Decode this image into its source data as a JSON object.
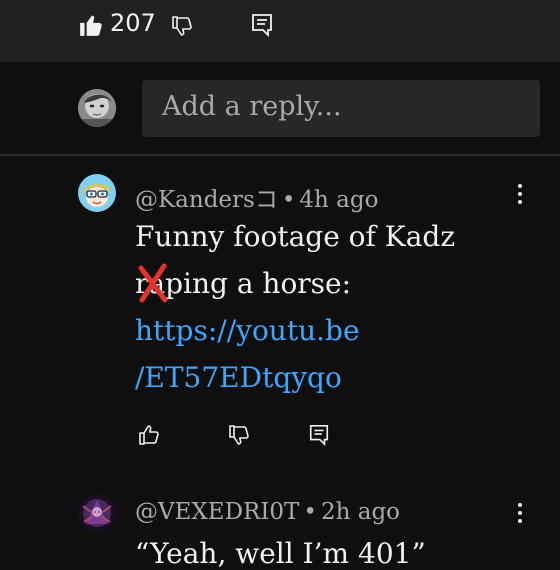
{
  "top_actions": {
    "like_count": "207"
  },
  "reply_input": {
    "placeholder": "Add a reply..."
  },
  "comments": [
    {
      "handle": "@Kandersコ",
      "time": "4h ago",
      "line1": "Funny footage of Kadz",
      "line2": "raping a horse:",
      "link_line1": "https://youtu.be",
      "link_line2": "/ET57EDtqyqo"
    },
    {
      "handle": "@VEXEDRI0T",
      "time": "2h ago",
      "line1": "“Yeah, well I’m 401”"
    }
  ],
  "colors": {
    "background": "#0f0f0f",
    "topbar": "#212121",
    "link": "#3ea6ff",
    "input": "#272727",
    "scribble": "#e5312b"
  },
  "icons": [
    "thumbs-up-filled-icon",
    "thumbs-down-outline-icon",
    "reply-comment-icon",
    "more-vertical-icon",
    "thumbs-up-outline-icon"
  ]
}
